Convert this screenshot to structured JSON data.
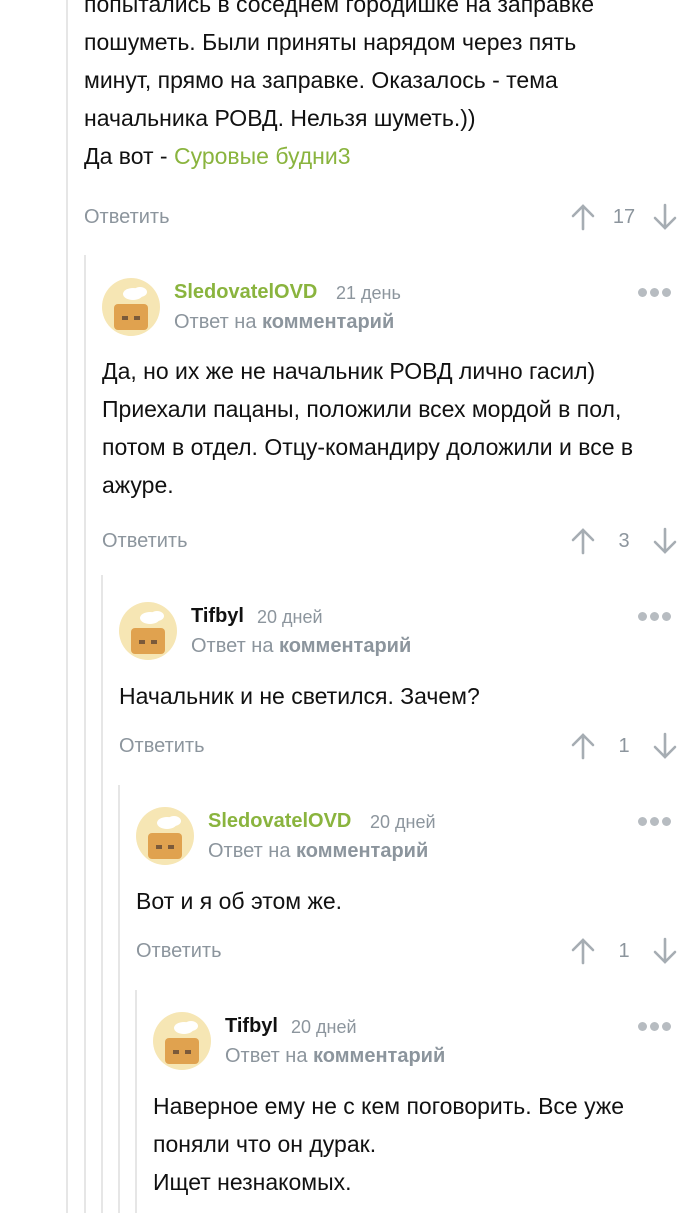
{
  "comments": [
    {
      "text_lines": [
        "попытались в соседнем городишке на заправке",
        "пошуметь. Были приняты нарядом через пять",
        "минут, прямо на заправке. Оказалось - тема",
        "начальника РОВД. Нельзя шуметь.))"
      ],
      "link_prefix": "Да вот - ",
      "link_text": "Суровые будни3",
      "reply_label": "Ответить",
      "score": "17"
    },
    {
      "author": "SledovatelOVD",
      "date": "21 день",
      "reply_to_prefix": "Ответ на ",
      "reply_to_link": "комментарий",
      "text_lines": [
        "Да, но их же не начальник РОВД лично гасил)",
        "Приехали пацаны, положили всех мордой в пол,",
        "потом в отдел. Отцу-командиру доложили и все в",
        "ажуре."
      ],
      "reply_label": "Ответить",
      "score": "3",
      "author_color": "#8ab43e"
    },
    {
      "author": "Tifbyl",
      "date": "20 дней",
      "reply_to_prefix": "Ответ на ",
      "reply_to_link": "комментарий",
      "text_lines": [
        "Начальник и не светился. Зачем?"
      ],
      "reply_label": "Ответить",
      "score": "1",
      "author_color": "#111111"
    },
    {
      "author": "SledovatelOVD",
      "date": "20 дней",
      "reply_to_prefix": "Ответ на ",
      "reply_to_link": "комментарий",
      "text_lines": [
        "Вот и я об этом же."
      ],
      "reply_label": "Ответить",
      "score": "1",
      "author_color": "#8ab43e"
    },
    {
      "author": "Tifbyl",
      "date": "20 дней",
      "reply_to_prefix": "Ответ на ",
      "reply_to_link": "комментарий",
      "text_lines": [
        "Наверное ему не с кем поговорить. Все уже",
        "поняли что он дурак.",
        "Ищет незнакомых."
      ],
      "author_color": "#111111"
    }
  ],
  "icons": {
    "upvote": "arrow-up-icon",
    "downvote": "arrow-down-icon",
    "more": "more-dots-icon",
    "avatar": "default-avatar-icon"
  }
}
